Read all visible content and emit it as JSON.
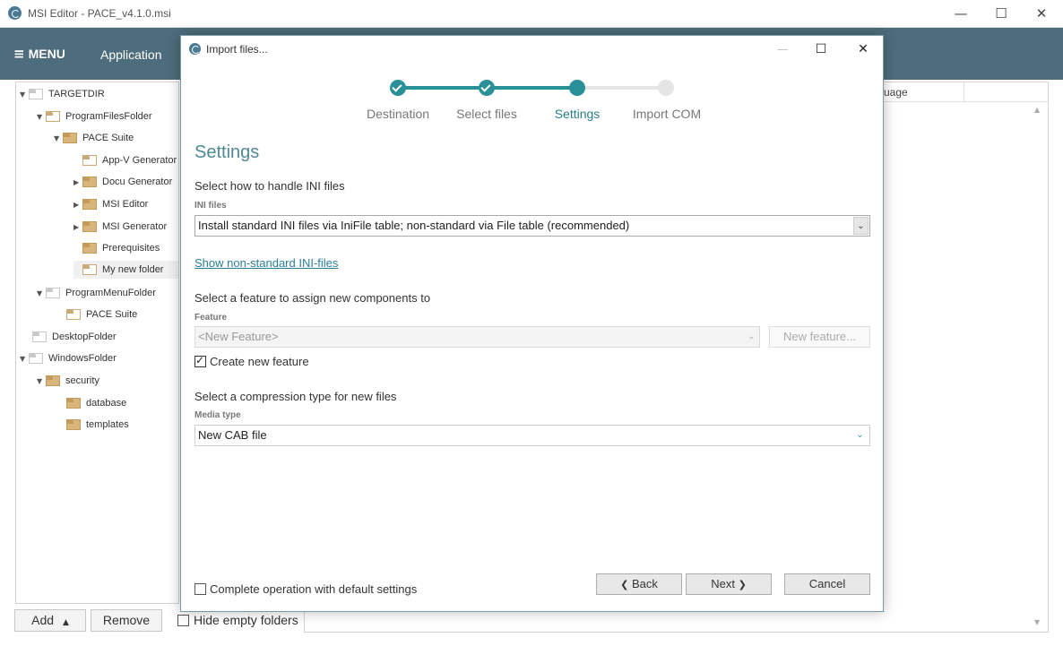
{
  "window": {
    "title": "MSI Editor - PACE_v4.1.0.msi",
    "minimize": "—",
    "maximize": "☐",
    "close": "✕"
  },
  "menubar": {
    "menu_label": "MENU",
    "menu_icon": "≡",
    "tab_application": "Application"
  },
  "tree": {
    "items": [
      {
        "label": "TARGETDIR",
        "expander": "▼"
      },
      {
        "label": "ProgramFilesFolder",
        "expander": "▼"
      },
      {
        "label": "PACE Suite",
        "expander": "▼"
      },
      {
        "label": "App-V Generator",
        "expander": ""
      },
      {
        "label": "Docu Generator",
        "expander": "▶"
      },
      {
        "label": "MSI Editor",
        "expander": "▶"
      },
      {
        "label": "MSI Generator",
        "expander": "▶"
      },
      {
        "label": "Prerequisites",
        "expander": ""
      },
      {
        "label": "My new folder",
        "expander": ""
      },
      {
        "label": "ProgramMenuFolder",
        "expander": "▼"
      },
      {
        "label": "PACE Suite",
        "expander": ""
      },
      {
        "label": "DesktopFolder",
        "expander": ""
      },
      {
        "label": "WindowsFolder",
        "expander": "▼"
      },
      {
        "label": "security",
        "expander": "▼"
      },
      {
        "label": "database",
        "expander": ""
      },
      {
        "label": "templates",
        "expander": ""
      }
    ]
  },
  "bottombar": {
    "add_label": "Add",
    "add_arrow": "▲",
    "remove_label": "Remove",
    "hide_empty_label": "Hide empty folders"
  },
  "rightpanel": {
    "column_header": "uage",
    "scroll_up": "▲",
    "scroll_down": "▼"
  },
  "dialog": {
    "title": "Import files...",
    "minimize": "—",
    "maximize": "☐",
    "close": "✕",
    "steps": [
      {
        "label": "Destination",
        "state": "done"
      },
      {
        "label": "Select files",
        "state": "done"
      },
      {
        "label": "Settings",
        "state": "active"
      },
      {
        "label": "Import COM",
        "state": "todo"
      }
    ],
    "heading": "Settings",
    "ini": {
      "section": "Select how to handle INI files",
      "field_label": "INI files",
      "value": "Install standard INI files via IniFile table; non-standard via File table (recommended)",
      "show_link": "Show non-standard INI-files"
    },
    "feature": {
      "section": "Select a feature to assign new components to",
      "field_label": "Feature",
      "value": "<New Feature>",
      "new_button": "New feature...",
      "create_label": "Create new feature",
      "create_checked": true
    },
    "media": {
      "section": "Select a compression type for new files",
      "field_label": "Media type",
      "value": "New CAB file"
    },
    "footer": {
      "default_label": "Complete operation with default settings",
      "back_label": "Back",
      "back_arrow": "❮",
      "next_label": "Next",
      "next_arrow": "❯",
      "cancel_label": "Cancel"
    },
    "chevron": "⌄"
  },
  "colors": {
    "accent": "#2a9098",
    "menubar": "#4d6d7c",
    "folder": "#d8b57a",
    "link": "#2a7e9a"
  }
}
